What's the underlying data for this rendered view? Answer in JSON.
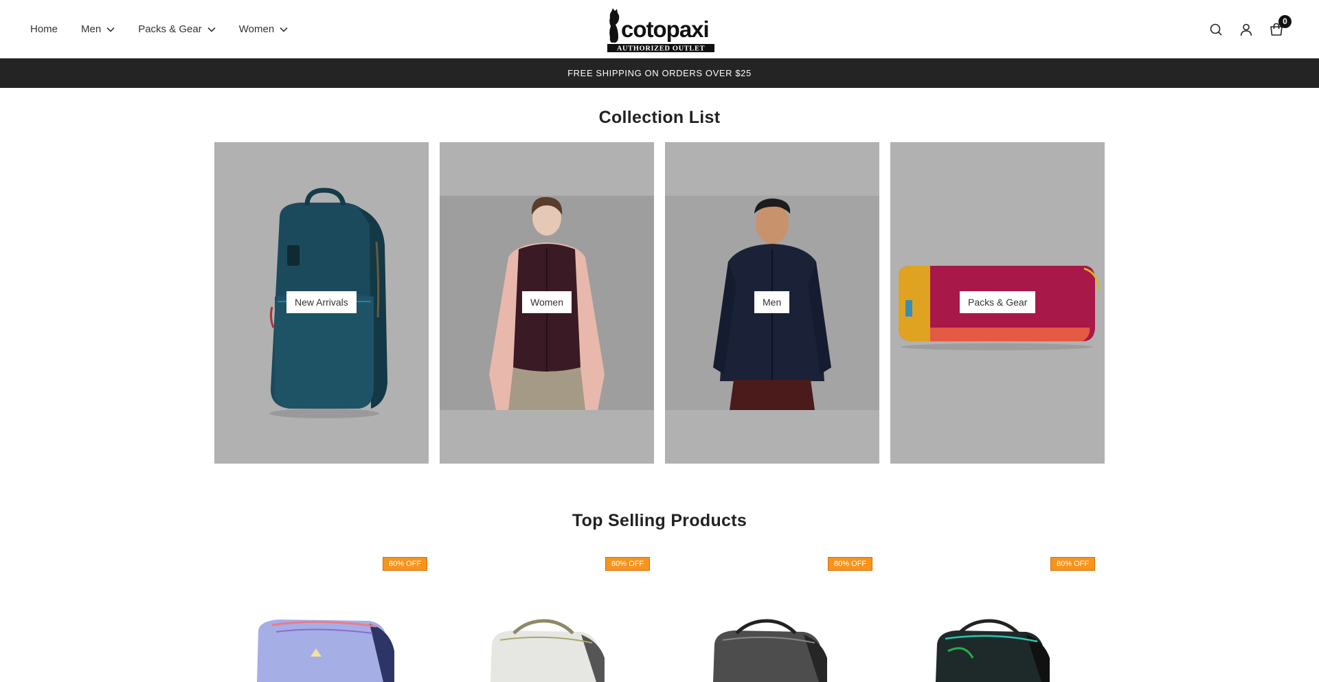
{
  "header": {
    "nav": [
      {
        "label": "Home",
        "has_dropdown": false
      },
      {
        "label": "Men",
        "has_dropdown": true
      },
      {
        "label": "Packs & Gear",
        "has_dropdown": true
      },
      {
        "label": "Women",
        "has_dropdown": true
      }
    ],
    "logo": {
      "wordmark": "cotopaxi",
      "subtitle": "AUTHORIZED OUTLET"
    },
    "icons": [
      "search-icon",
      "account-icon",
      "cart-icon"
    ],
    "cart_count": "0"
  },
  "announcement": "FREE SHIPPING ON ORDERS OVER $25",
  "collections": {
    "title": "Collection List",
    "items": [
      {
        "label": "New Arrivals"
      },
      {
        "label": "Women"
      },
      {
        "label": "Men"
      },
      {
        "label": "Packs & Gear"
      }
    ]
  },
  "top_selling": {
    "title": "Top Selling Products",
    "products": [
      {
        "badge": "80% OFF"
      },
      {
        "badge": "80% OFF"
      },
      {
        "badge": "80% OFF"
      },
      {
        "badge": "80% OFF"
      }
    ]
  },
  "colors": {
    "announcement_bg": "#242424",
    "card_bg": "#b1b1b1",
    "badge_bg": "#f7941d",
    "text": "#222222"
  }
}
